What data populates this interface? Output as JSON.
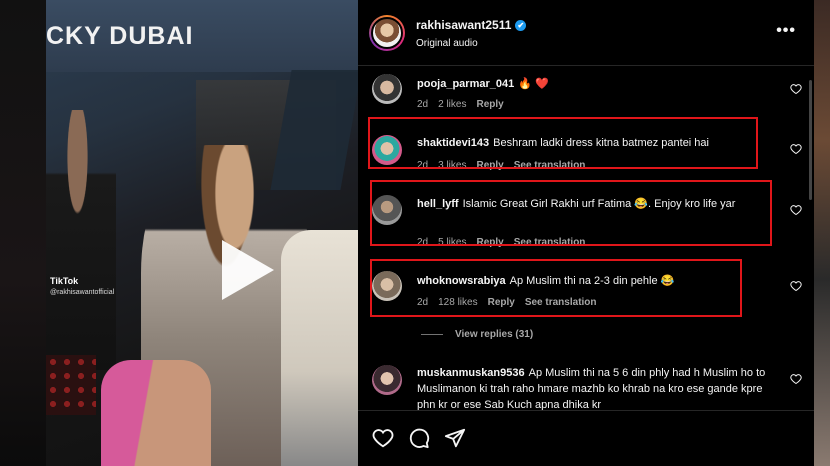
{
  "video": {
    "sign_text": "CKY DUBAI",
    "tiktok_label": "TikTok",
    "tiktok_handle": "@rakhisawantofficial"
  },
  "post": {
    "username": "rakhisawant2511",
    "verified_mark": "✔",
    "audio": "Original audio",
    "more_label": "•••"
  },
  "comments": [
    {
      "user": "pooja_parmar_041",
      "text": "🔥 ❤️",
      "age": "2d",
      "likes": "2 likes",
      "reply": "Reply",
      "translation": "",
      "highlighted": false
    },
    {
      "user": "shaktidevi143",
      "text": "Beshram ladki dress kitna batmez pantei hai",
      "age": "2d",
      "likes": "3 likes",
      "reply": "Reply",
      "translation": "See translation",
      "highlighted": true
    },
    {
      "user": "hell_lyff",
      "text": "Islamic Great Girl Rakhi urf Fatima 😂. Enjoy kro life yar",
      "age": "2d",
      "likes": "5 likes",
      "reply": "Reply",
      "translation": "See translation",
      "highlighted": true
    },
    {
      "user": "whoknowsrabiya",
      "text": "Ap Muslim thi na 2-3 din pehle 😂",
      "age": "2d",
      "likes": "128 likes",
      "reply": "Reply",
      "translation": "See translation",
      "highlighted": true
    },
    {
      "user": "muskanmuskan9536",
      "text": "Ap Muslim thi na 5 6 din phly had h Muslim ho to Muslimanon ki trah raho hmare mazhb ko khrab na kro ese gande kpre phn kr or ese Sab Kuch apna dhika kr",
      "age": "",
      "likes": "",
      "reply": "",
      "translation": "",
      "highlighted": false
    }
  ],
  "view_replies": "View replies (31)",
  "colors": {
    "highlight_box": "#e0161a",
    "meta_text": "#a8a8a8",
    "background": "#000000"
  },
  "icons": [
    "heart-icon",
    "comment-icon",
    "share-icon",
    "more-icon",
    "play-icon",
    "verified-icon"
  ]
}
